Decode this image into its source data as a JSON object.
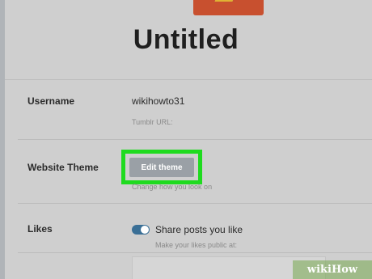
{
  "blog": {
    "title": "Untitled"
  },
  "settings": {
    "username": {
      "label": "Username",
      "value": "wikihowto31",
      "sub": "Tumblr URL:"
    },
    "theme": {
      "label": "Website Theme",
      "button": "Edit theme",
      "sub": "Change how you look on"
    },
    "likes": {
      "label": "Likes",
      "toggle_label": "Share posts you like",
      "toggle_on": true,
      "sub": "Make your likes public at:"
    }
  },
  "colors": {
    "highlight": "#1fdb1f",
    "toggle": "#3a6f96",
    "avatar": "#c8502f"
  },
  "watermark": {
    "text": "wikiHow"
  }
}
